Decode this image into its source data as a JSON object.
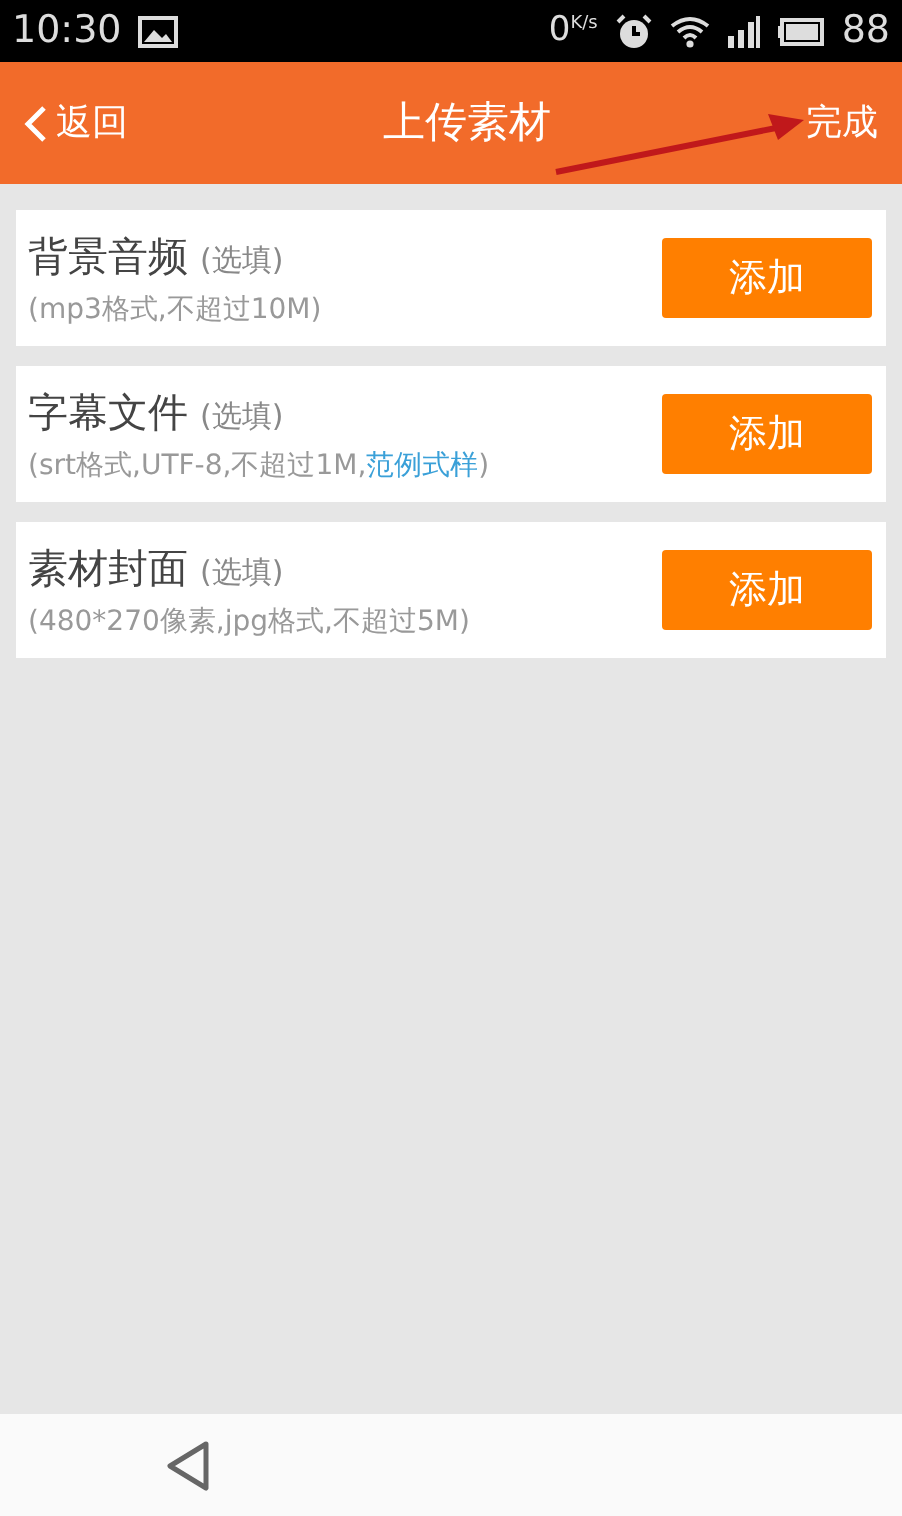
{
  "status_bar": {
    "time": "10:30",
    "speed_value": "0",
    "speed_unit": "K/s",
    "battery": "88"
  },
  "header": {
    "back": "返回",
    "title": "上传素材",
    "done": "完成"
  },
  "items": [
    {
      "title": "背景音频",
      "optional": "(选填)",
      "note": "(mp3格式,不超过10M)",
      "button": "添加"
    },
    {
      "title": "字幕文件",
      "optional": "(选填)",
      "note": "(srt格式,UTF-8,不超过1M,",
      "link": "范例式样",
      "note_end": ")",
      "button": "添加"
    },
    {
      "title": "素材封面",
      "optional": "(选填)",
      "note": "(480*270像素,jpg格式,不超过5M)",
      "button": "添加"
    }
  ]
}
